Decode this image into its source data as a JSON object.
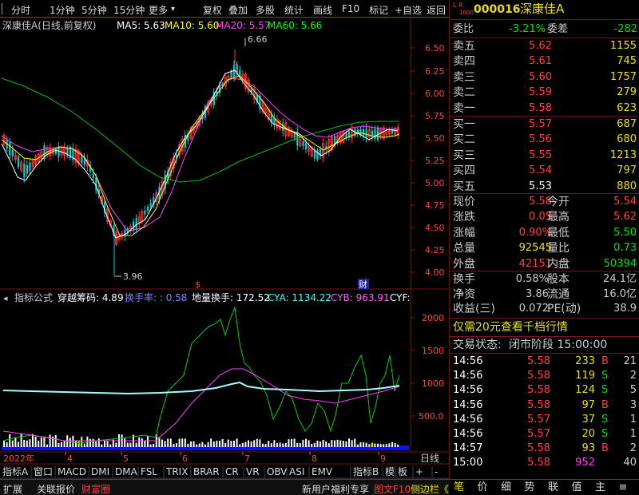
{
  "toolbar": {
    "items": [
      "分时",
      "1分钟",
      "5分钟",
      "15分钟",
      "更多",
      "复权",
      "叠加",
      "多股",
      "统计",
      "画线",
      "F10",
      "标记",
      "+自选",
      "返回"
    ],
    "more_arrow": "▾"
  },
  "main": {
    "title": "深康佳A(日线,前复权)",
    "ma": [
      {
        "label": "MA5: 5.63",
        "color": "#ffffff"
      },
      {
        "label": "MA10: 5.60",
        "color": "#ffff00"
      },
      {
        "label": "MA20: 5.57",
        "color": "#ff40ff"
      },
      {
        "label": "MA60: 5.66",
        "color": "#00ff00"
      }
    ],
    "price_ticks": [
      "6.50",
      "6.25",
      "6.00",
      "5.75",
      "5.50",
      "5.25",
      "5.00",
      "4.75",
      "4.50",
      "4.25",
      "4.00"
    ],
    "high_label": "6.66",
    "low_label": "3.96",
    "marker_s": "$",
    "marker_cai": "财"
  },
  "indicator": {
    "title": "指标公式",
    "items": [
      {
        "label": "穿越筹码: 4.89",
        "color": "#ffffff"
      },
      {
        "label": "换手率: : 0.58",
        "color": "#8080ff"
      },
      {
        "label": "地量换手: 172.52",
        "color": "#ffffff"
      },
      {
        "label": "CYA: 1134.22",
        "color": "#40ffff"
      },
      {
        "label": "CYB: 963.91",
        "color": "#ff60ff"
      },
      {
        "label": "CYF:",
        "color": "#ffffff"
      }
    ],
    "ticks": [
      "2000",
      "1500",
      "1000",
      "500.0"
    ]
  },
  "xaxis": {
    "labels": [
      "2022年",
      "4",
      "5",
      "6",
      "7",
      "8",
      "9"
    ],
    "right": "日线"
  },
  "bottom_tabs": [
    "指标A",
    "窗口",
    "MACD",
    "DMI",
    "DMA",
    "FSL",
    "TRIX",
    "BRAR",
    "CR",
    "VR",
    "OBV",
    "ASI",
    "EMV",
    "指标B",
    "模",
    "板",
    "+",
    "-"
  ],
  "footer": {
    "items": [
      "扩展",
      "关联报价",
      "财富圈"
    ],
    "promo": "新用户福利专享",
    "f10": "图文F10",
    "side": "侧边栏《"
  },
  "side": {
    "code": "000016",
    "name": "深康佳Α",
    "lr": "L R",
    "lr_sub": "1000",
    "weibi_label": "委比",
    "weibi": "-3.21%",
    "weicha_label": "委差",
    "weicha": "-282",
    "asks": [
      {
        "label": "卖五",
        "price": "5.62",
        "vol": "1155"
      },
      {
        "label": "卖四",
        "price": "5.61",
        "vol": "745"
      },
      {
        "label": "卖三",
        "price": "5.60",
        "vol": "1757"
      },
      {
        "label": "卖二",
        "price": "5.59",
        "vol": "279"
      },
      {
        "label": "卖一",
        "price": "5.58",
        "vol": "623"
      }
    ],
    "bids": [
      {
        "label": "买一",
        "price": "5.57",
        "vol": "687"
      },
      {
        "label": "买二",
        "price": "5.56",
        "vol": "680"
      },
      {
        "label": "买三",
        "price": "5.55",
        "vol": "1213"
      },
      {
        "label": "买四",
        "price": "5.54",
        "vol": "797"
      },
      {
        "label": "买五",
        "price": "5.53",
        "vol": "880"
      }
    ],
    "quote": [
      {
        "l1": "现价",
        "v1": "5.58",
        "c1": "#ff4040",
        "l2": "今开",
        "v2": "5.54",
        "c2": "#ff4040"
      },
      {
        "l1": "涨跌",
        "v1": "0.05",
        "c1": "#ff4040",
        "l2": "最高",
        "v2": "5.62",
        "c2": "#ff4040"
      },
      {
        "l1": "涨幅",
        "v1": "0.90%",
        "c1": "#ff4040",
        "l2": "最低",
        "v2": "5.50",
        "c2": "#00e000"
      },
      {
        "l1": "总量",
        "v1": "92545",
        "c1": "#e8e000",
        "l2": "量比",
        "v2": "0.73",
        "c2": "#00e000"
      },
      {
        "l1": "外盘",
        "v1": "42151",
        "c1": "#ff4040",
        "l2": "内盘",
        "v2": "50394",
        "c2": "#00e000"
      }
    ],
    "fund": [
      {
        "l1": "换手",
        "v1": "0.58%",
        "l2": "股本",
        "v2": "24.1亿"
      },
      {
        "l1": "净资",
        "v1": "3.86",
        "l2": "流通",
        "v2": "16.0亿"
      },
      {
        "l1": "收益(三)",
        "v1": "0.072",
        "l2": "PE(动)",
        "v2": "38.9"
      }
    ],
    "promo": "仅需20元查看千档行情",
    "status_label": "交易状态:",
    "status": "闭市阶段 15:00:00",
    "ticks": [
      {
        "t": "14:56",
        "p": "5.58",
        "pc": "#ff4040",
        "v": "233",
        "vc": "#e8e000",
        "d": "B",
        "dc": "#ff4040",
        "n": "21"
      },
      {
        "t": "14:56",
        "p": "5.58",
        "pc": "#ff4040",
        "v": "119",
        "vc": "#e8e000",
        "d": "S",
        "dc": "#00e000",
        "n": "2"
      },
      {
        "t": "14:56",
        "p": "5.58",
        "pc": "#ff4040",
        "v": "124",
        "vc": "#e8e000",
        "d": "S",
        "dc": "#00e000",
        "n": "5"
      },
      {
        "t": "14:56",
        "p": "5.58",
        "pc": "#ff4040",
        "v": "97",
        "vc": "#e8e000",
        "d": "B",
        "dc": "#ff4040",
        "n": "3"
      },
      {
        "t": "14:56",
        "p": "5.57",
        "pc": "#ff4040",
        "v": "37",
        "vc": "#e8e000",
        "d": "S",
        "dc": "#00e000",
        "n": "1"
      },
      {
        "t": "14:56",
        "p": "5.57",
        "pc": "#ff4040",
        "v": "20",
        "vc": "#e8e000",
        "d": "S",
        "dc": "#00e000",
        "n": "1"
      },
      {
        "t": "14:57",
        "p": "5.58",
        "pc": "#ff4040",
        "v": "93",
        "vc": "#e8e000",
        "d": "B",
        "dc": "#ff4040",
        "n": "2"
      },
      {
        "t": "15:00",
        "p": "5.58",
        "pc": "#ff4040",
        "v": "952",
        "vc": "#ff40ff",
        "d": "",
        "dc": "#fff",
        "n": "40"
      }
    ],
    "tabs": [
      "笔",
      "价",
      "细",
      "势",
      "联",
      "值",
      "主",
      "≡"
    ]
  }
}
